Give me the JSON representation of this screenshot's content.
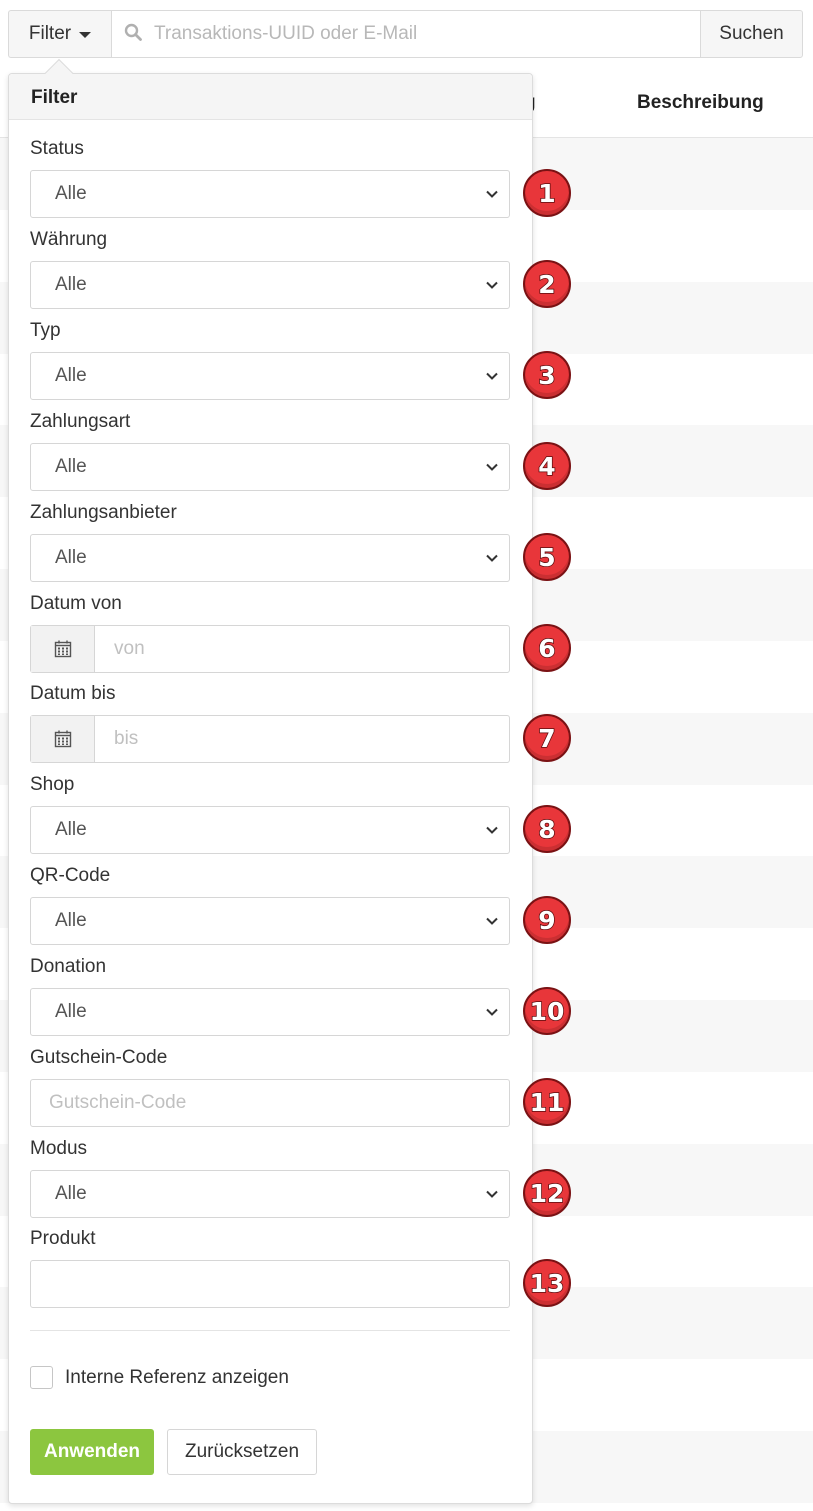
{
  "toolbar": {
    "filter_label": "Filter",
    "search_placeholder": "Transaktions-UUID oder E-Mail",
    "search_button": "Suchen"
  },
  "table": {
    "partial_header": "g",
    "description_header": "Beschreibung"
  },
  "panel": {
    "title": "Filter",
    "fields": [
      {
        "label": "Status",
        "kind": "select",
        "value": "Alle",
        "badge": "1"
      },
      {
        "label": "Währung",
        "kind": "select",
        "value": "Alle",
        "badge": "2"
      },
      {
        "label": "Typ",
        "kind": "select",
        "value": "Alle",
        "badge": "3"
      },
      {
        "label": "Zahlungsart",
        "kind": "select",
        "value": "Alle",
        "badge": "4"
      },
      {
        "label": "Zahlungsanbieter",
        "kind": "select",
        "value": "Alle",
        "badge": "5"
      },
      {
        "label": "Datum von",
        "kind": "date",
        "placeholder": "von",
        "badge": "6"
      },
      {
        "label": "Datum bis",
        "kind": "date",
        "placeholder": "bis",
        "badge": "7"
      },
      {
        "label": "Shop",
        "kind": "select",
        "value": "Alle",
        "badge": "8"
      },
      {
        "label": "QR-Code",
        "kind": "select",
        "value": "Alle",
        "badge": "9"
      },
      {
        "label": "Donation",
        "kind": "select",
        "value": "Alle",
        "badge": "10"
      },
      {
        "label": "Gutschein-Code",
        "kind": "text",
        "placeholder": "Gutschein-Code",
        "badge": "11"
      },
      {
        "label": "Modus",
        "kind": "select",
        "value": "Alle",
        "badge": "12"
      },
      {
        "label": "Produkt",
        "kind": "text",
        "placeholder": "",
        "badge": "13"
      }
    ],
    "checkbox_label": "Interne Referenz anzeigen",
    "checkbox_checked": false,
    "apply_button": "Anwenden",
    "reset_button": "Zurücksetzen"
  },
  "colors": {
    "apply": "#8cc63f",
    "badge": "#e8363a"
  }
}
